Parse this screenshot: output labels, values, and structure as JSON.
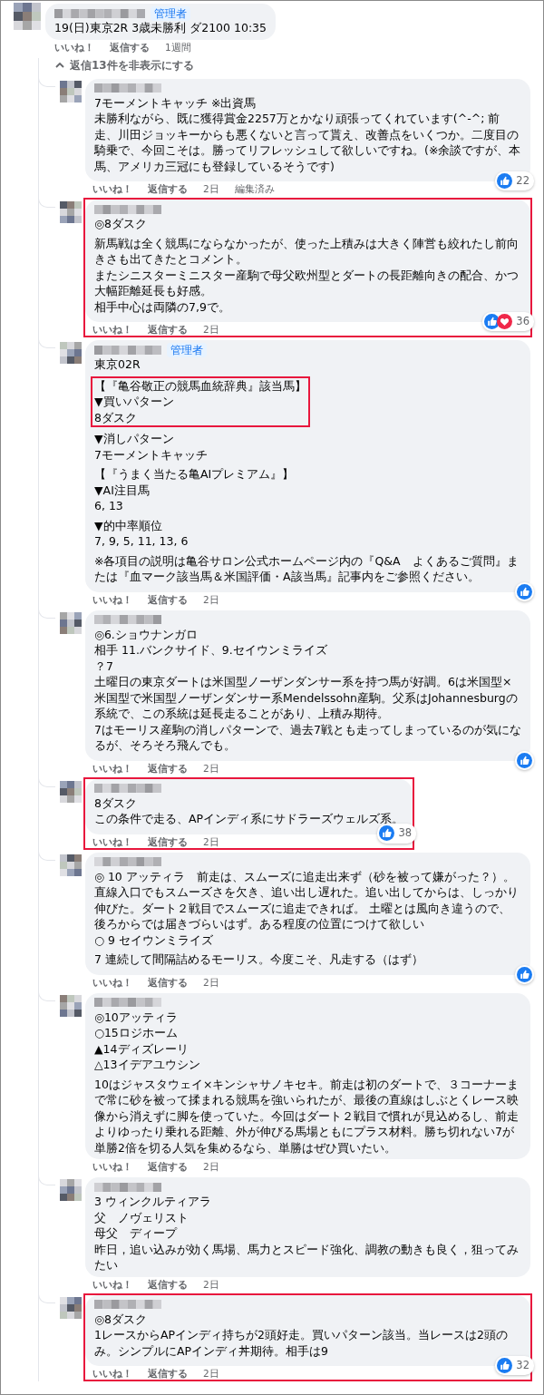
{
  "comment": {
    "admin_badge": "管理者",
    "text": "19(日)東京2R 3歳未勝利 ダ2100 10:35",
    "actions": [
      "いいね！",
      "返信する",
      "1週間"
    ]
  },
  "replies_toggle": "返信13件を非表示にする",
  "replies": [
    {
      "highlighted": false,
      "blocks": [
        {
          "lines": [
            "7モーメントキャッチ ※出資馬",
            "未勝利ながら、既に獲得賞金2257万とかなり頑張ってくれています(^-^; 前走、川田ジョッキーからも悪くないと言って貰え、改善点をいくつか。二度目の騎乗で、今回こそは。勝ってリフレッシュして欲しいですね。(※余談ですが、本馬、アメリカ三冠にも登録しているそうです)"
          ],
          "boxed": false
        }
      ],
      "actions": [
        "いいね！",
        "返信する",
        "2日",
        "編集済み"
      ],
      "reaction_badge": true,
      "reaction_count": "22"
    },
    {
      "highlighted": true,
      "blocks": [
        {
          "lines": [
            "◎8ダスク"
          ],
          "boxed": false
        },
        {
          "lines": [
            "新馬戦は全く競馬にならなかったが、使った上積みは大きく陣営も絞れたし前向きさも出てきたとコメント。",
            "またシニスターミニスター産駒で母父欧州型とダートの長距離向きの配合、かつ大幅距離延長も好感。",
            "相手中心は両隣の7,9で。"
          ],
          "boxed": false
        }
      ],
      "actions": [
        "いいね！",
        "返信する",
        "2日"
      ],
      "reaction_badge": true,
      "heart": true,
      "reaction_count": "36"
    },
    {
      "admin_badge": "管理者",
      "highlighted": false,
      "blocks": [
        {
          "lines": [
            "東京02R"
          ],
          "boxed": false
        },
        {
          "lines": [
            "【『亀谷敬正の競馬血統辞典』該当馬】",
            "▼買いパターン",
            "8ダスク"
          ],
          "boxed": true
        },
        {
          "lines": [
            "▼消しパターン",
            "7モーメントキャッチ"
          ],
          "boxed": false
        },
        {
          "lines": [
            "【『うまく当たる亀AIプレミアム』】",
            "▼AI注目馬",
            "6, 13"
          ],
          "boxed": false
        },
        {
          "lines": [
            "▼的中率順位",
            "7, 9, 5, 11, 13, 6"
          ],
          "boxed": false
        },
        {
          "lines": [
            "※各項目の説明は亀谷サロン公式ホームページ内の『Q&A　よくあるご質問』または『血マーク該当馬＆米国評価・A該当馬』記事内をご参照ください。"
          ],
          "boxed": false
        }
      ],
      "actions": [
        "いいね！",
        "返信する",
        "2日"
      ],
      "reaction_badge": true
    },
    {
      "highlighted": false,
      "blocks": [
        {
          "lines": [
            "◎6.ショウナンガロ",
            "相手 11.バンクサイド、9.セイウンミライズ",
            "？7",
            "土曜日の東京ダートは米国型ノーザンダンサー系を持つ馬が好調。6は米国型×米国型で米国型ノーザンダンサー系Mendelssohn産駒。父系はJohannesburgの系統で、この系統は延長走ることがあり、上積み期待。",
            "7はモーリス産駒の消しパターンで、過去7戦とも走ってしまっているのが気になるが、そろそろ飛んでも。"
          ],
          "boxed": false
        }
      ],
      "actions": [
        "いいね！",
        "返信する",
        "2日"
      ],
      "reaction_badge": true
    },
    {
      "highlighted": true,
      "blocks": [
        {
          "lines": [
            "8ダスク",
            "この条件で走る、APインディ系にサドラーズウェルズ系。"
          ],
          "boxed": false
        }
      ],
      "actions": [
        "いいね！",
        "返信する",
        "2日"
      ],
      "reaction_badge": true,
      "reaction_count": "38"
    },
    {
      "highlighted": false,
      "blocks": [
        {
          "lines": [
            "◎ 10 アッティラ　前走は、スムーズに追走出来ず（砂を被って嫌がった？）。直線入口でもスムーズさを欠き、追い出し遅れた。追い出してからは、しっかり伸びた。ダート２戦目でスムーズに追走できれば。 土曜とは風向き違うので、後ろからでは届きづらいはず。ある程度の位置につけて欲しい",
            "○ 9 セイウンミライズ"
          ],
          "boxed": false
        },
        {
          "lines": [
            "7 連続して間隔詰めるモーリス。今度こそ、凡走する（はず）"
          ],
          "boxed": false
        }
      ],
      "actions": [
        "いいね！",
        "返信する",
        "2日"
      ],
      "reaction_badge": true
    },
    {
      "highlighted": false,
      "blocks": [
        {
          "lines": [
            "◎10アッティラ",
            "○15ロジホーム",
            "▲14ディズレーリ",
            "△13イデアユウシン"
          ],
          "boxed": false
        },
        {
          "lines": [
            "10はジャスタウェイ×キンシャサノキセキ。前走は初のダートで、３コーナーまで常に砂を被って揉まれる競馬を強いられたが、最後の直線はしぶとくレース映像から消えずに脚を使っていた。今回はダート２戦目で慣れが見込めるし、前走よりゆったり乗れる距離、外が伸びる馬場ともにプラス材料。勝ち切れない7が単勝2倍を切る人気を集めるなら、単勝はぜひ買いたい。"
          ],
          "boxed": false
        }
      ],
      "actions": [
        "いいね！",
        "返信する",
        "2日"
      ]
    },
    {
      "highlighted": false,
      "blocks": [
        {
          "lines": [
            "3 ウィンクルティアラ",
            "父　ノヴェリスト",
            "母父　ディープ",
            "昨日，追い込みが効く馬場、馬力とスピード強化、調教の動きも良く，狙ってみたい"
          ],
          "boxed": false
        }
      ],
      "actions": [
        "いいね！",
        "返信する",
        "2日"
      ]
    },
    {
      "highlighted": true,
      "blocks": [
        {
          "lines": [
            "◎8ダスク",
            "1レースからAPインディ持ちが2頭好走。買いパターン該当。当レースは2頭のみ。シンプルにAPインディ丼期待。相手は9"
          ],
          "boxed": false
        }
      ],
      "actions": [
        "いいね！",
        "返信する",
        "2日"
      ],
      "reaction_badge": true,
      "reaction_count": "32"
    }
  ]
}
